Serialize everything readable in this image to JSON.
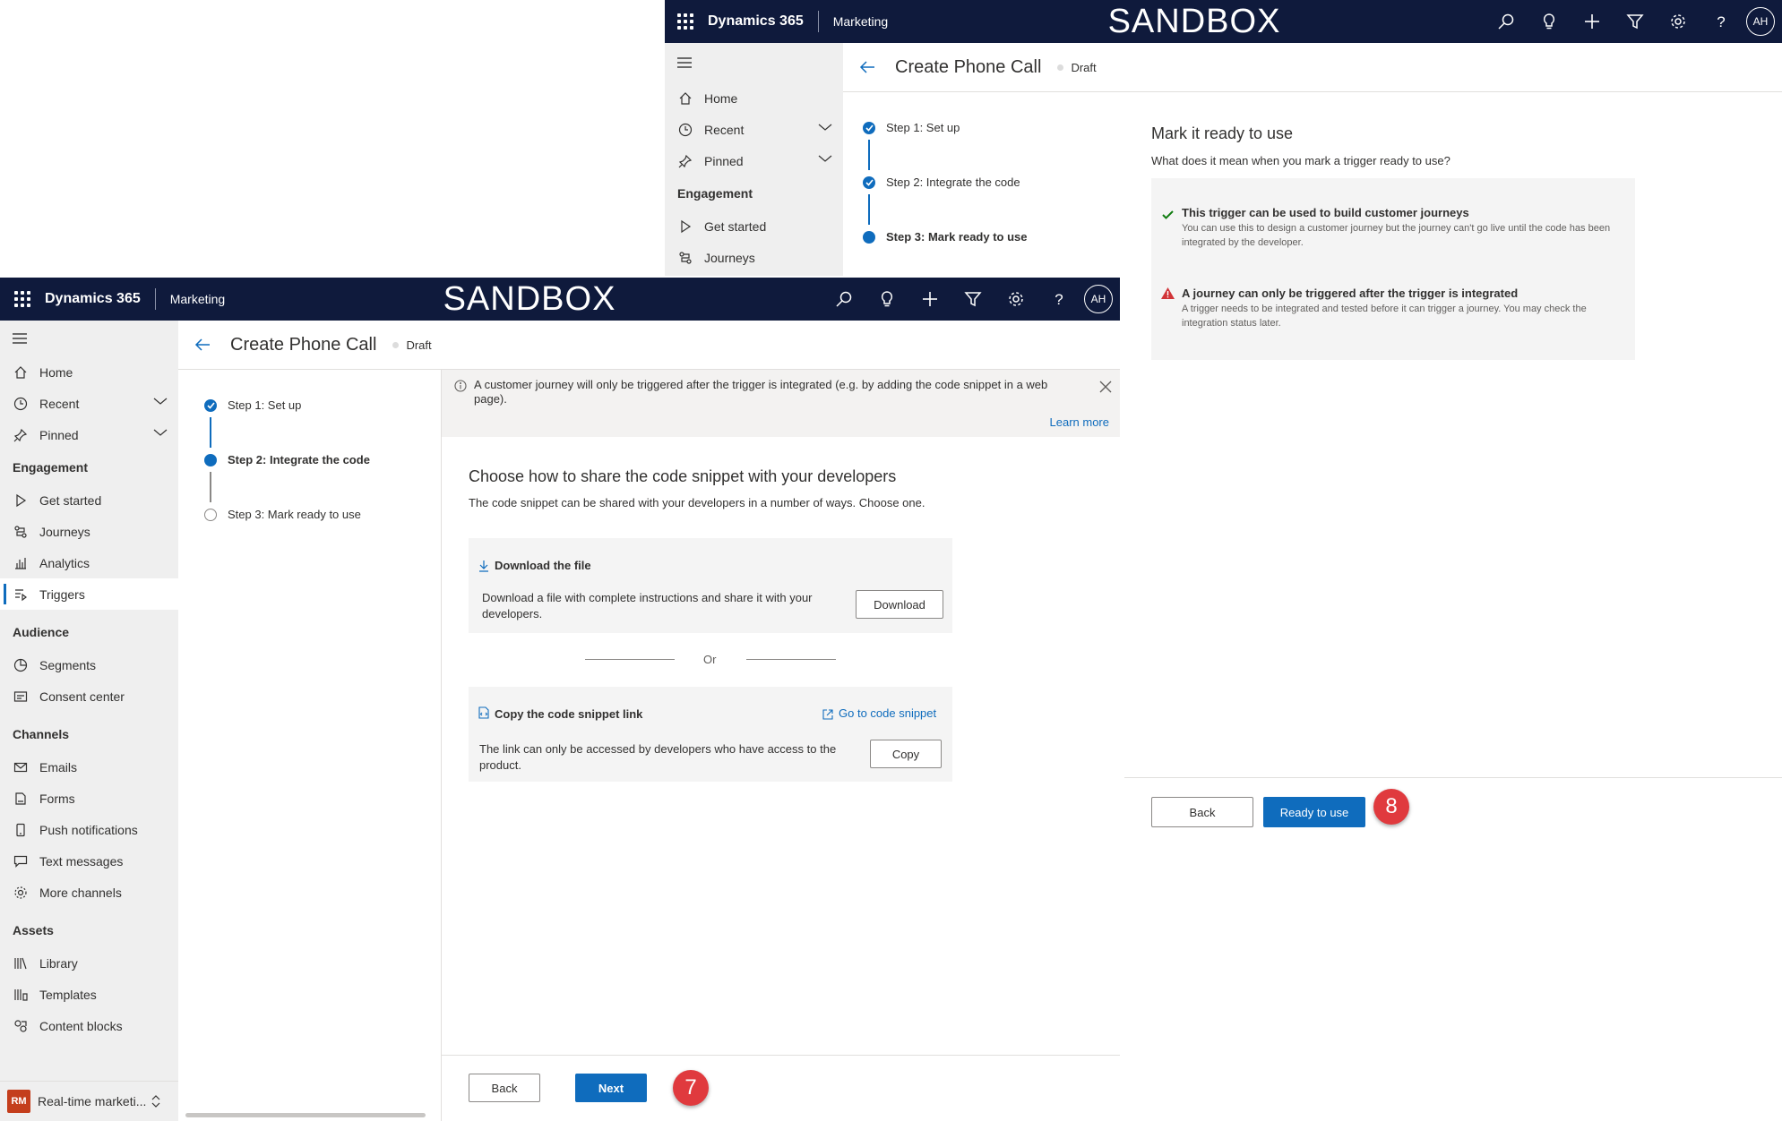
{
  "topbar": {
    "brand": "Dynamics 365",
    "app": "Marketing",
    "env": "SANDBOX",
    "avatar": "AH",
    "icons": [
      "search-icon",
      "lightbulb-icon",
      "plus-icon",
      "filter-icon",
      "gear-icon",
      "help-icon"
    ]
  },
  "nav": {
    "home": "Home",
    "recent": "Recent",
    "pinned": "Pinned",
    "groups": {
      "engagement": "Engagement",
      "audience": "Audience",
      "channels": "Channels",
      "assets": "Assets"
    },
    "engagement_items": [
      "Get started",
      "Journeys",
      "Analytics",
      "Triggers"
    ],
    "audience_items": [
      "Segments",
      "Consent center"
    ],
    "channel_items": [
      "Emails",
      "Forms",
      "Push notifications",
      "Text messages",
      "More channels"
    ],
    "asset_items": [
      "Library",
      "Templates",
      "Content blocks"
    ],
    "area": {
      "initials": "RM",
      "label": "Real-time marketi..."
    }
  },
  "page": {
    "title": "Create Phone Call",
    "status": "Draft"
  },
  "steps": [
    "Step 1: Set up",
    "Step 2: Integrate the code",
    "Step 3: Mark ready to use"
  ],
  "notice": {
    "text": "A customer journey will only be triggered after the trigger is integrated (e.g. by adding the code snippet in a web page).",
    "link": "Learn more"
  },
  "integrate": {
    "heading": "Choose how to share the code snippet with your developers",
    "subtitle": "The code snippet can be shared with your developers in a number of ways. Choose one.",
    "download": {
      "title": "Download the file",
      "desc": "Download a file with complete instructions and share it with your developers.",
      "button": "Download"
    },
    "or": "Or",
    "copy": {
      "title": "Copy the code snippet link",
      "link": "Go to code snippet",
      "desc": "The link can only be accessed by developers who have access to the product.",
      "button": "Copy"
    },
    "back": "Back",
    "next": "Next",
    "badge": "7"
  },
  "ready": {
    "heading": "Mark it ready to use",
    "question": "What does it mean when you mark a trigger ready to use?",
    "info1": {
      "title": "This trigger can be used to build customer journeys",
      "desc": "You can use this to design a customer journey but the journey can't go live until the code has been integrated by the developer."
    },
    "info2": {
      "title": "A journey can only be triggered after the trigger is integrated",
      "desc": "A trigger needs to be integrated and tested before it can trigger a journey. You may check the integration status later."
    },
    "back": "Back",
    "primary": "Ready to use",
    "badge": "8"
  },
  "colors": {
    "topbar": "#0f1a3c",
    "accent": "#0f6cbd",
    "badge": "#e03a3e",
    "success": "#107c10",
    "warning": "#d13438"
  }
}
